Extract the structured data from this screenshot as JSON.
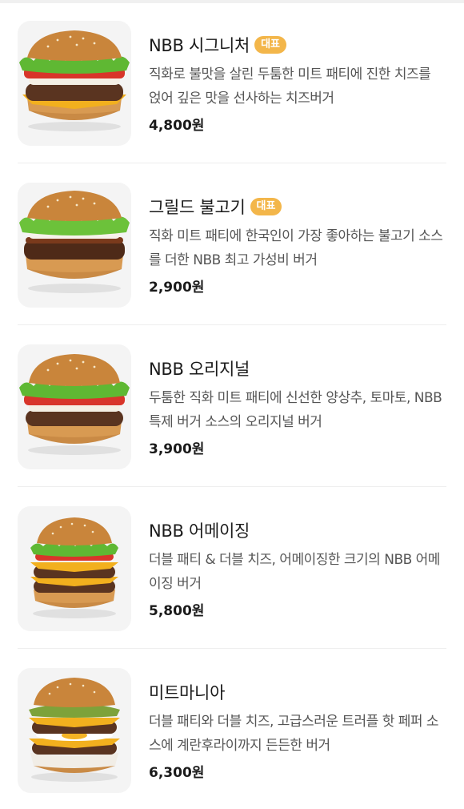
{
  "menu": {
    "items": [
      {
        "name": "NBB 시그니처",
        "badge": "대표",
        "description": "직화로 불맛을 살린 두툼한 미트 패티에 진한 치즈를 얹어 깊은 맛을 선사하는 치즈버거",
        "price": "4,800원",
        "image": "signature-burger-image"
      },
      {
        "name": "그릴드 불고기",
        "badge": "대표",
        "description": "직화 미트 패티에 한국인이 가장 좋아하는 불고기 소스를 더한 NBB 최고 가성비 버거",
        "price": "2,900원",
        "image": "bulgogi-burger-image"
      },
      {
        "name": "NBB 오리지널",
        "badge": "",
        "description": "두툼한 직화 미트 패티에 신선한 양상추, 토마토, NBB 특제 버거 소스의 오리지널 버거",
        "price": "3,900원",
        "image": "original-burger-image"
      },
      {
        "name": "NBB 어메이징",
        "badge": "",
        "description": "더블 패티 & 더블 치즈, 어메이징한 크기의 NBB 어메이징 버거",
        "price": "5,800원",
        "image": "amazing-burger-image"
      },
      {
        "name": "미트마니아",
        "badge": "",
        "description": "더블 패티와 더블 치즈, 고급스러운 트러플 핫 페퍼 소스에 계란후라이까지 든든한 버거",
        "price": "6,300원",
        "image": "meatmania-burger-image"
      }
    ]
  },
  "colors": {
    "badge": "#f3b64a",
    "bun": "#c9853b",
    "lettuce": "#5fb833",
    "tomato": "#d8352a",
    "cheese": "#f2b01e",
    "patty": "#5a3420"
  }
}
